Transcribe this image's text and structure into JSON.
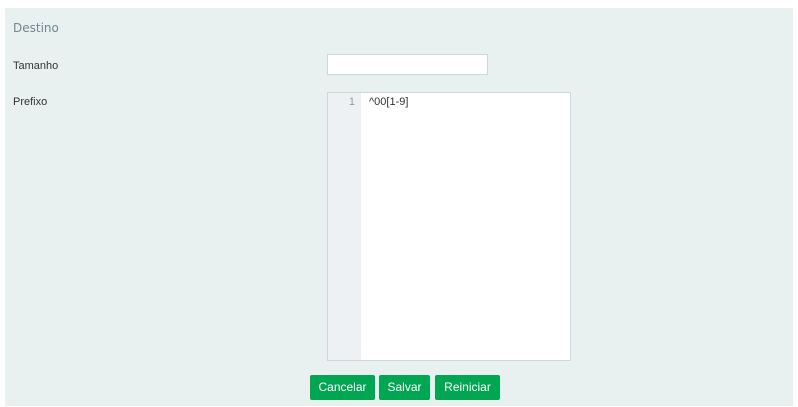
{
  "section": {
    "title": "Destino"
  },
  "fields": {
    "tamanho": {
      "label": "Tamanho",
      "value": "",
      "placeholder": ""
    },
    "prefixo": {
      "label": "Prefixo",
      "editor": {
        "line_numbers": [
          "1"
        ],
        "lines": [
          "^00[1-9]"
        ]
      }
    }
  },
  "buttons": {
    "cancel_label": "Cancelar",
    "save_label": "Salvar",
    "reset_label": "Reiniciar"
  },
  "colors": {
    "panel_bg": "#e9f0f0",
    "button_green": "#00a652",
    "section_title": "#6f8791"
  }
}
